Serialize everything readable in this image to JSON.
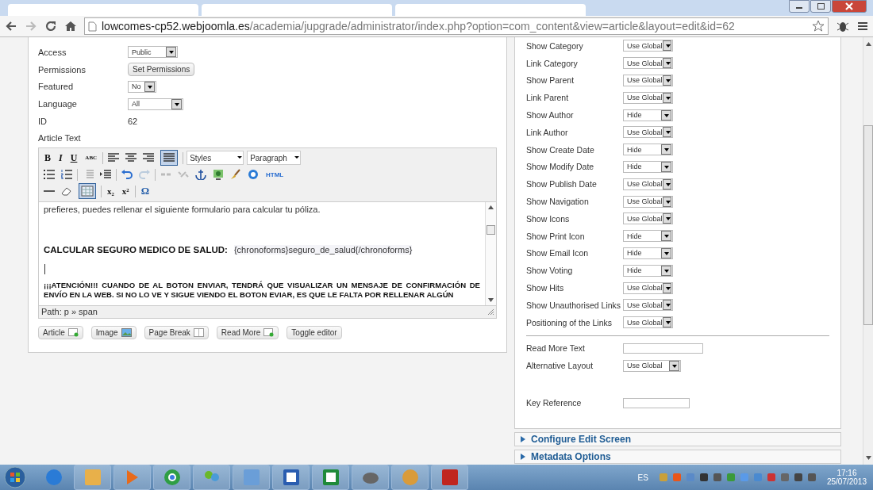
{
  "browser": {
    "url_host": "lowcomes-cp52.webjoomla.es",
    "url_path": "/academia/jupgrade/administrator/index.php?option=com_content&view=article&layout=edit&id=62"
  },
  "left": {
    "fields": [
      {
        "label": "Access",
        "kind": "select",
        "value": "Public"
      },
      {
        "label": "Permissions",
        "kind": "button",
        "value": "Set Permissions"
      },
      {
        "label": "Featured",
        "kind": "select",
        "value": "No"
      },
      {
        "label": "Language",
        "kind": "select",
        "value": "All"
      },
      {
        "label": "ID",
        "kind": "text",
        "value": "62"
      }
    ],
    "article_label": "Article Text"
  },
  "editor": {
    "toolbar": {
      "bold": "B",
      "italic": "I",
      "underline": "U",
      "strike": "ABC",
      "justify_pressed": true,
      "table_pressed": true,
      "styles": "Styles",
      "format": "Paragraph",
      "html": "HTML",
      "subscript": "x₂",
      "superscript": "x²",
      "omega": "Ω"
    },
    "intro": "prefieres, puedes rellenar el siguiente formulario para calcular tu póliza.",
    "heading": "CALCULAR SEGURO MEDICO DE SALUD:",
    "code": "{chronoforms}seguro_de_salud{/chronoforms}",
    "warning": "¡¡¡ATENCIÓN!!! CUANDO DE AL BOTON ENVIAR, TENDRÁ QUE VISUALIZAR UN MENSAJE DE CONFIRMACIÓN DE ENVÍO EN LA WEB. SI NO LO VE Y SIGUE VIENDO EL BOTON EVIAR, ES QUE LE FALTA POR RELLENAR ALGÚN",
    "path": "Path: p » span",
    "buttons": [
      {
        "label": "Article"
      },
      {
        "label": "Image"
      },
      {
        "label": "Page Break"
      },
      {
        "label": "Read More"
      },
      {
        "label": "Toggle editor"
      }
    ]
  },
  "right": {
    "options": [
      {
        "label": "Show Category",
        "value": "Use Global"
      },
      {
        "label": "Link Category",
        "value": "Use Global"
      },
      {
        "label": "Show Parent",
        "value": "Use Global"
      },
      {
        "label": "Link Parent",
        "value": "Use Global"
      },
      {
        "label": "Show Author",
        "value": "Hide"
      },
      {
        "label": "Link Author",
        "value": "Use Global"
      },
      {
        "label": "Show Create Date",
        "value": "Hide"
      },
      {
        "label": "Show Modify Date",
        "value": "Hide"
      },
      {
        "label": "Show Publish Date",
        "value": "Use Global"
      },
      {
        "label": "Show Navigation",
        "value": "Use Global"
      },
      {
        "label": "Show Icons",
        "value": "Use Global"
      },
      {
        "label": "Show Print Icon",
        "value": "Hide"
      },
      {
        "label": "Show Email Icon",
        "value": "Hide"
      },
      {
        "label": "Show Voting",
        "value": "Hide"
      },
      {
        "label": "Show Hits",
        "value": "Use Global"
      },
      {
        "label": "Show Unauthorised Links",
        "value": "Use Global"
      },
      {
        "label": "Positioning of the Links",
        "value": "Use Global"
      }
    ],
    "read_more_label": "Read More Text",
    "layout_label": "Alternative Layout",
    "layout_value": "Use Global",
    "key_label": "Key Reference",
    "sections": [
      {
        "label": "Configure Edit Screen",
        "expanded": false
      },
      {
        "label": "Metadata Options",
        "expanded": false
      }
    ]
  },
  "taskbar": {
    "language": "ES",
    "time": "17:16",
    "date": "25/07/2013"
  }
}
